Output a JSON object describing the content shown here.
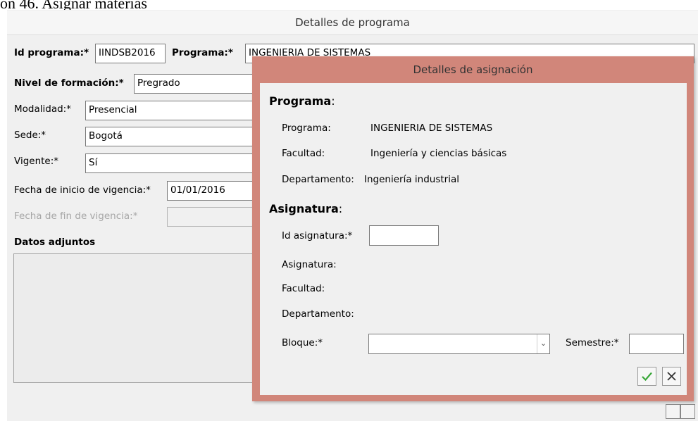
{
  "caption": "ón 46. Asignar materias",
  "window": {
    "title": "Detalles de programa",
    "fields": {
      "id_programa_label": "Id programa:*",
      "id_programa_value": "IINDSB2016",
      "programa_label": "Programa:*",
      "programa_value": "INGENIERIA DE SISTEMAS",
      "nivel_label": "Nivel de formación:*",
      "nivel_value": "Pregrado",
      "modalidad_label": "Modalidad:*",
      "modalidad_value": "Presencial",
      "sede_label": "Sede:*",
      "sede_value": "Bogotá",
      "vigente_label": "Vigente:*",
      "vigente_value": "Sí",
      "fecha_inicio_label": "Fecha de inicio de vigencia:*",
      "fecha_inicio_value": "01/01/2016",
      "fecha_fin_label": "Fecha de fin de vigencia:*",
      "fecha_fin_value": ""
    },
    "datos_adjuntos_label": "Datos adjuntos"
  },
  "dialog": {
    "title": "Detalles de asignación",
    "programa_section": {
      "heading": "Programa",
      "programa_label": "Programa:",
      "programa_value": "INGENIERIA DE SISTEMAS",
      "facultad_label": "Facultad:",
      "facultad_value": "Ingeniería y ciencias básicas",
      "departamento_label": "Departamento:",
      "departamento_value": "Ingeniería industrial"
    },
    "asignatura_section": {
      "heading": "Asignatura",
      "id_label": "Id asignatura:*",
      "id_value": "",
      "asignatura_label": "Asignatura:",
      "facultad_label": "Facultad:",
      "departamento_label": "Departamento:",
      "bloque_label": "Bloque:*",
      "bloque_value": "",
      "semestre_label": "Semestre:*",
      "semestre_value": ""
    },
    "buttons": {
      "accept_icon": "check-icon",
      "cancel_icon": "close-icon",
      "accept_color": "#3aa83a"
    }
  }
}
